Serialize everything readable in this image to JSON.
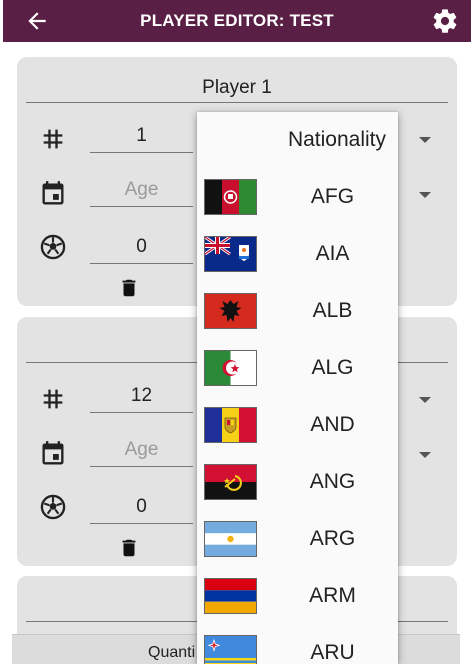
{
  "appbar": {
    "title": "PLAYER EDITOR: TEST",
    "back_icon": "arrow-left-icon",
    "settings_icon": "gear-icon",
    "color": "#5a1f45"
  },
  "player1": {
    "name": "Player 1",
    "number": "1",
    "age_placeholder": "Age",
    "goals": "0"
  },
  "player2": {
    "name": "",
    "number": "12",
    "age_placeholder": "Age",
    "goals": "0"
  },
  "dropdown": {
    "header": "Nationality",
    "items": [
      {
        "code": "AFG",
        "flag": "afghanistan-flag"
      },
      {
        "code": "AIA",
        "flag": "anguilla-flag"
      },
      {
        "code": "ALB",
        "flag": "albania-flag"
      },
      {
        "code": "ALG",
        "flag": "algeria-flag"
      },
      {
        "code": "AND",
        "flag": "andorra-flag"
      },
      {
        "code": "ANG",
        "flag": "angola-flag"
      },
      {
        "code": "ARG",
        "flag": "argentina-flag"
      },
      {
        "code": "ARM",
        "flag": "armenia-flag"
      },
      {
        "code": "ARU",
        "flag": "aruba-flag"
      }
    ]
  },
  "bottom_bar": {
    "label": "Quanti"
  }
}
